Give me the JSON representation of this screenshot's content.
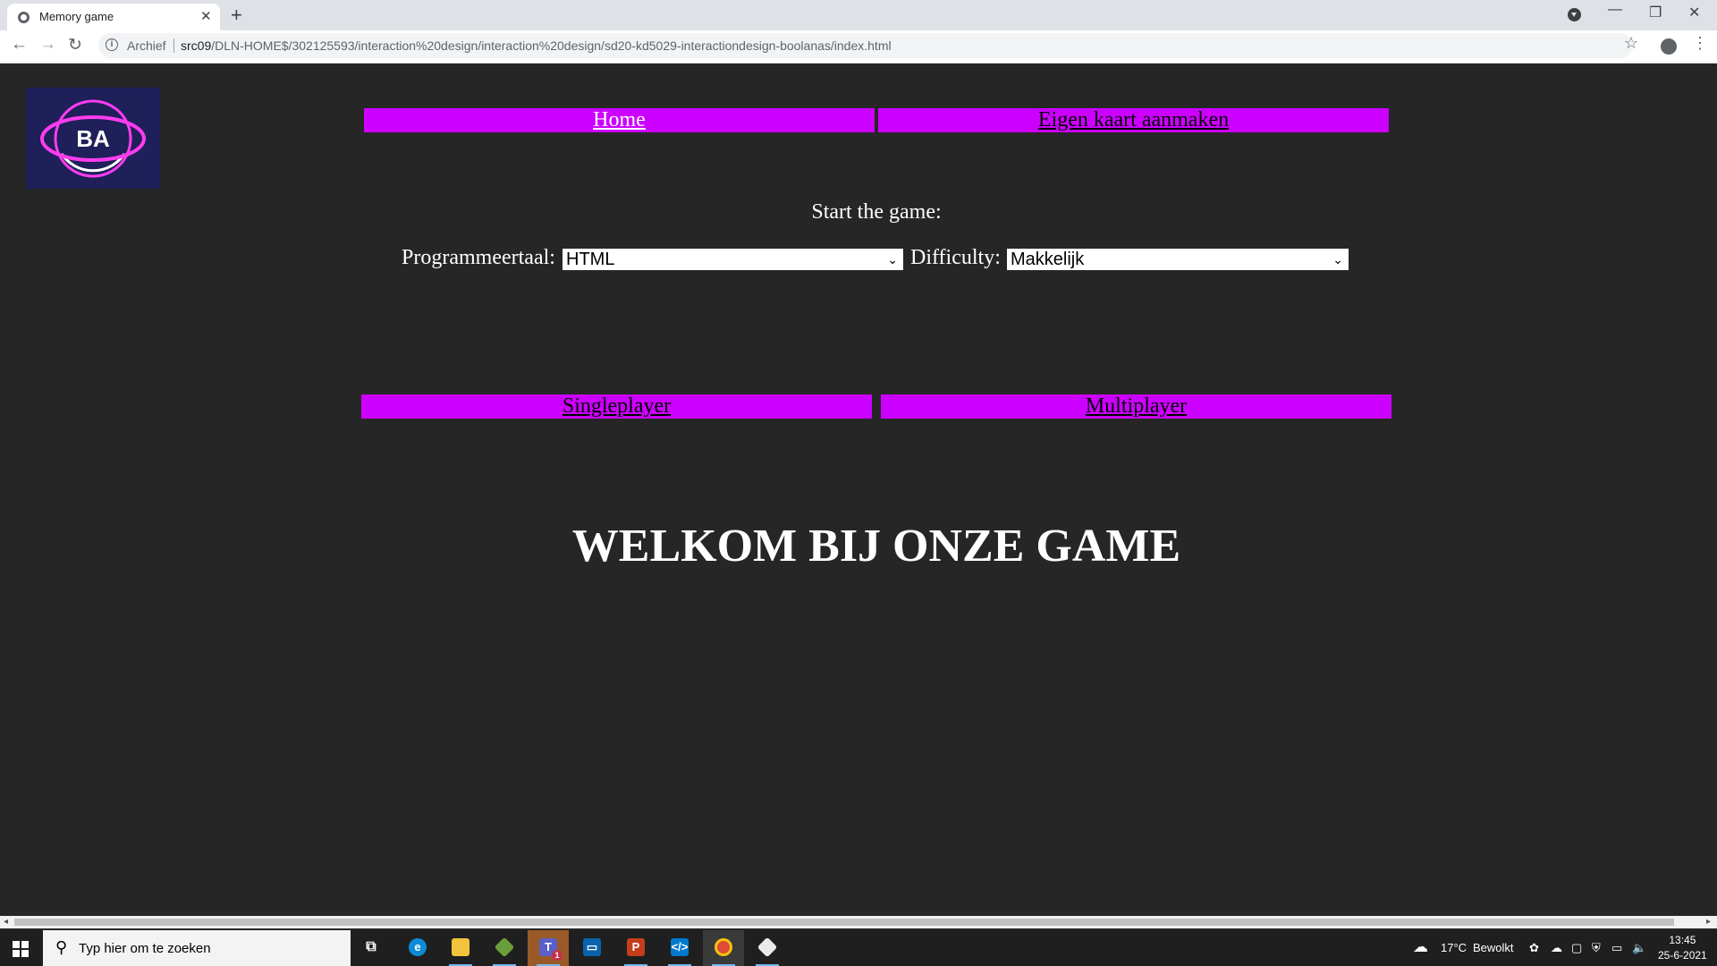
{
  "browser": {
    "tab_title": "Memory game",
    "close_glyph": "✕",
    "newtab_glyph": "+",
    "archive_label": "Archief",
    "url_host": "src09",
    "url_path": "/DLN-HOME$/302125593/interaction%20design/interaction%20design/sd20-kd5029-interactiondesign-boolanas/index.html",
    "icons": [
      "back-icon",
      "forward-icon",
      "reload-icon",
      "info-icon",
      "star-icon",
      "profile-icon",
      "menu-icon"
    ]
  },
  "page": {
    "logo_text": "BA",
    "nav": {
      "home": "Home",
      "create_card": "Eigen kaart aanmaken"
    },
    "start_label": "Start the game:",
    "language_label": "Programmeertaal:",
    "language_value": "HTML",
    "difficulty_label": "Difficulty:",
    "difficulty_value": "Makkelijk",
    "singleplayer": "Singleplayer",
    "multiplayer": "Multiplayer",
    "welcome": "WELKOM BIJ ONZE GAME",
    "colors": {
      "background": "#262626",
      "accent": "#cc00ff",
      "logo_bg": "#1f1f5a"
    }
  },
  "taskbar": {
    "search_placeholder": "Typ hier om te zoeken",
    "weather_temp": "17°C",
    "weather_text": "Bewolkt",
    "time": "13:45",
    "date": "25-6-2021",
    "teams_badge": "1",
    "apps": [
      "task-view",
      "edge",
      "file-explorer",
      "git-client",
      "teams",
      "outlook",
      "powerpoint",
      "vscode",
      "chrome",
      "git-client-2"
    ]
  }
}
